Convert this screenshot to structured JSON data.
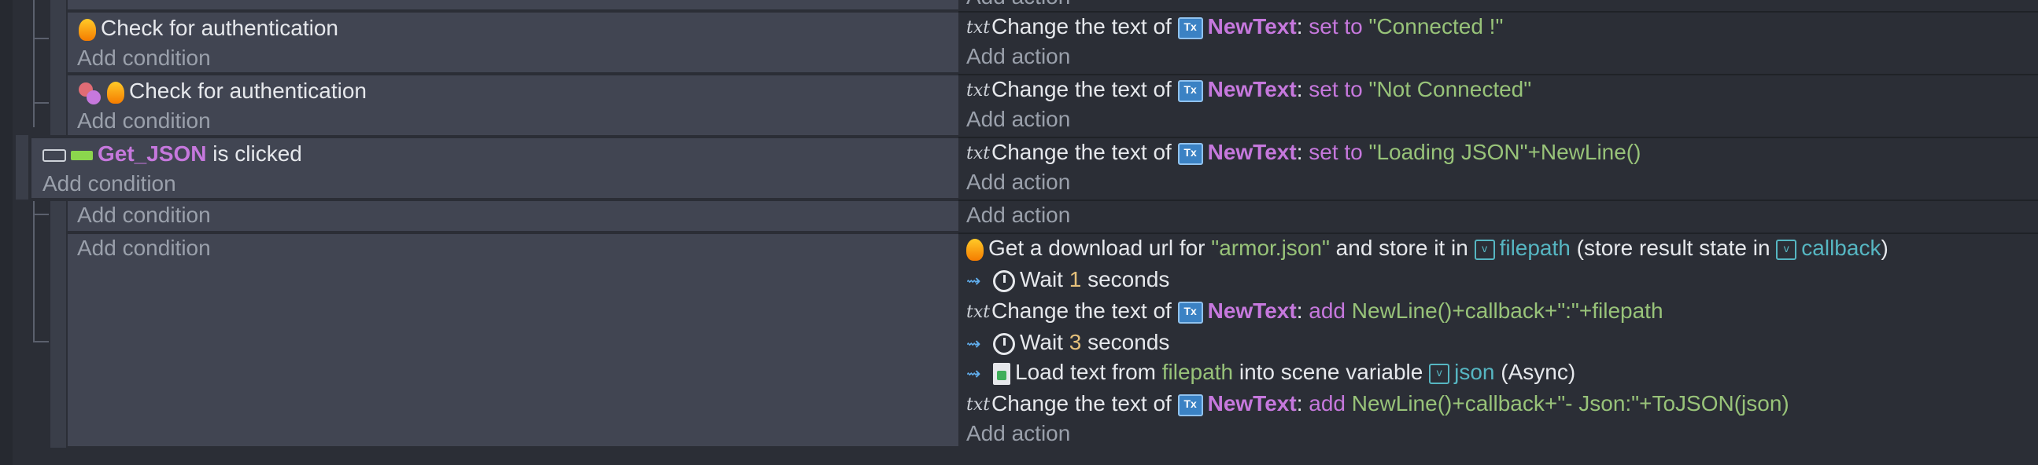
{
  "rows": {
    "row0": {
      "action": "Add action"
    },
    "row1": {
      "condition": "Check for authentication",
      "add_condition": "Add condition",
      "action": {
        "prefix": "Change the text of",
        "object": "NewText",
        "colon": ":",
        "op": "set to",
        "value": "\"Connected !\""
      },
      "add_action": "Add action"
    },
    "row2": {
      "condition": "Check for authentication",
      "add_condition": "Add condition",
      "action": {
        "prefix": "Change the text of",
        "object": "NewText",
        "colon": ":",
        "op": "set to",
        "value": "\"Not Connected\""
      },
      "add_action": "Add action"
    },
    "row3": {
      "object": "Get_JSON",
      "condition_suffix": "is clicked",
      "add_condition": "Add condition",
      "action": {
        "prefix": "Change the text of",
        "object": "NewText",
        "colon": ":",
        "op": "set to",
        "value": "\"Loading JSON\"+NewLine()"
      },
      "add_action": "Add action"
    },
    "row4": {
      "add_condition": "Add condition",
      "add_action": "Add action"
    },
    "row5": {
      "add_condition": "Add condition",
      "a1": {
        "t1": "Get a download url for",
        "s1": "\"armor.json\"",
        "t2": "and store it in",
        "v1": "filepath",
        "t3": "(store result state in",
        "v2": "callback",
        "t4": ")"
      },
      "a2": {
        "t1": "Wait",
        "n1": "1",
        "t2": "seconds"
      },
      "a3": {
        "prefix": "Change the text of",
        "object": "NewText",
        "colon": ":",
        "op": "add",
        "value": "NewLine()+callback+\":\"+filepath"
      },
      "a4": {
        "t1": "Wait",
        "n1": "3",
        "t2": "seconds"
      },
      "a5": {
        "t1": "Load text from",
        "s1": "filepath",
        "t2": "into scene variable",
        "v1": "json",
        "t3": "(Async)"
      },
      "a6": {
        "prefix": "Change the text of",
        "object": "NewText",
        "colon": ":",
        "op": "add",
        "value": "NewLine()+callback+\"- Json:\"+ToJSON(json)"
      },
      "add_action": "Add action"
    }
  },
  "icons": {
    "text_action": "txt-icon",
    "firebase": "flame-icon",
    "text_object": "text-object-icon",
    "variable": "variable-icon",
    "invert": "invert-condition-icon",
    "async": "async-icon",
    "timer": "timer-icon",
    "file": "file-icon",
    "button": "button-icon",
    "bar": "bar-icon"
  },
  "colors": {
    "background": "#2b2e36",
    "condition_bg": "#414552",
    "object": "#c678dd",
    "string": "#98c379",
    "number": "#e5c07b",
    "variable": "#56b6c2"
  }
}
